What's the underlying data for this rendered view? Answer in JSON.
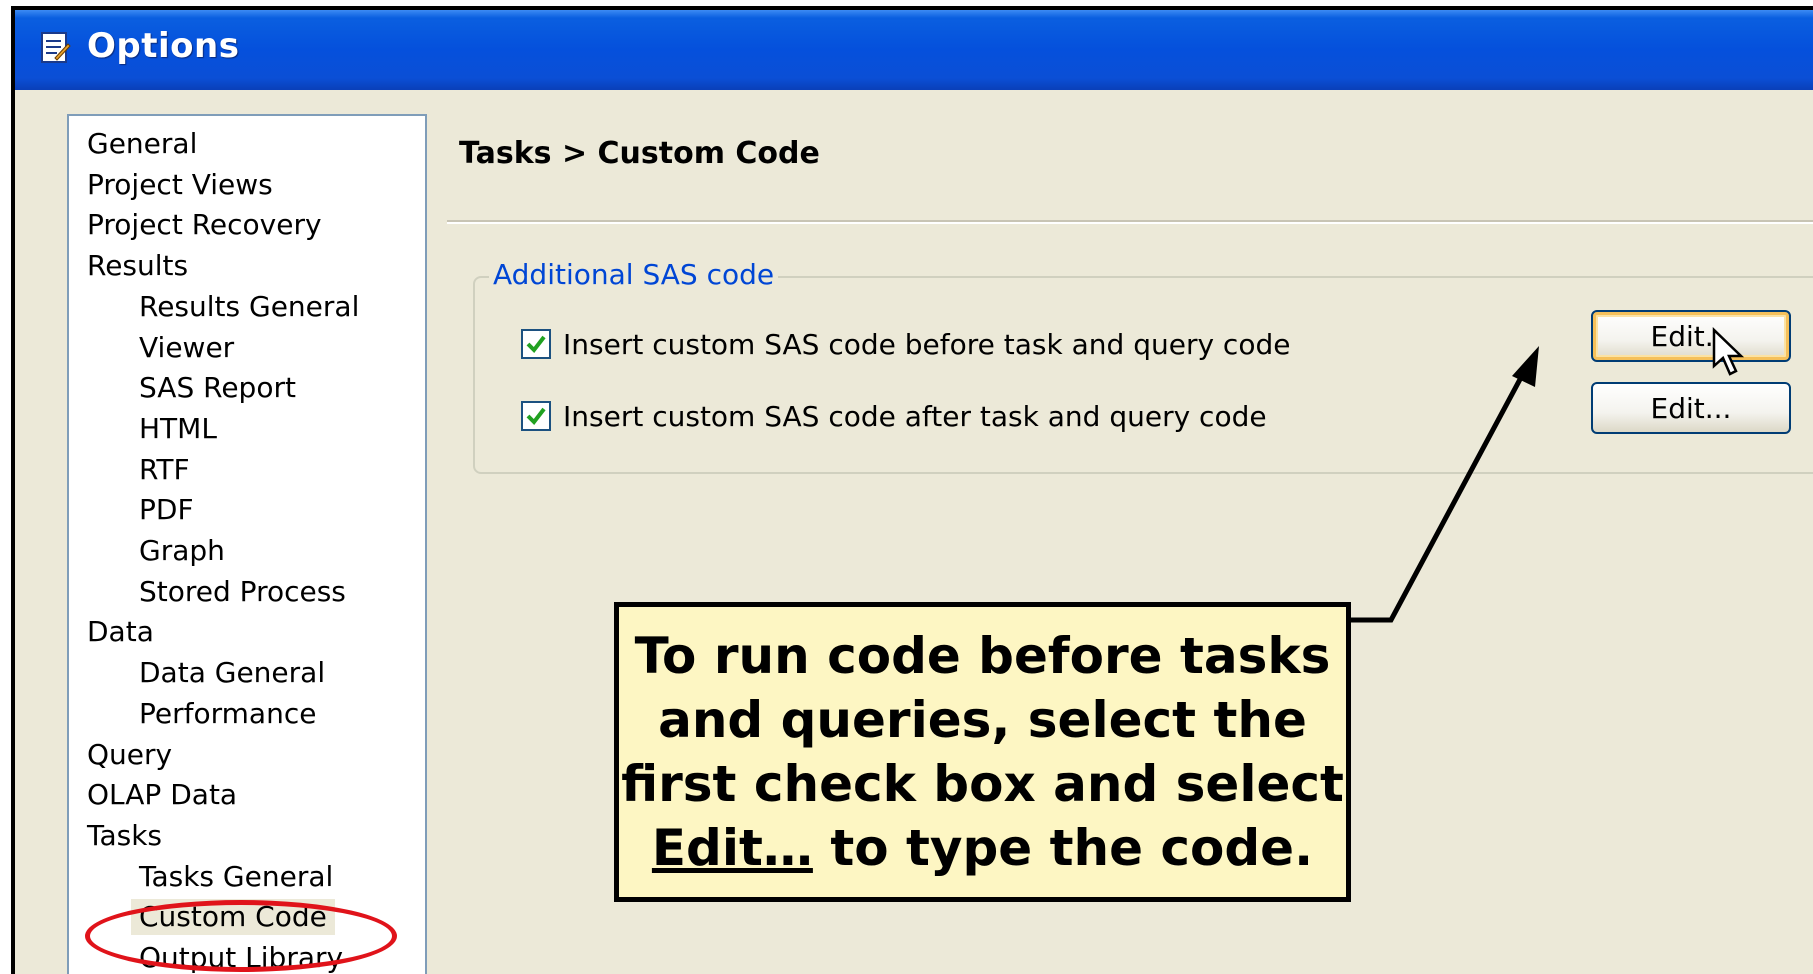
{
  "window": {
    "title": "Options",
    "icon": "options-dialog-icon"
  },
  "nav": {
    "items": [
      {
        "label": "General",
        "level": 0
      },
      {
        "label": "Project Views",
        "level": 0
      },
      {
        "label": "Project Recovery",
        "level": 0
      },
      {
        "label": "Results",
        "level": 0
      },
      {
        "label": "Results General",
        "level": 1
      },
      {
        "label": "Viewer",
        "level": 1
      },
      {
        "label": "SAS Report",
        "level": 1
      },
      {
        "label": "HTML",
        "level": 1
      },
      {
        "label": "RTF",
        "level": 1
      },
      {
        "label": "PDF",
        "level": 1
      },
      {
        "label": "Graph",
        "level": 1
      },
      {
        "label": "Stored Process",
        "level": 1
      },
      {
        "label": "Data",
        "level": 0
      },
      {
        "label": "Data General",
        "level": 1
      },
      {
        "label": "Performance",
        "level": 1
      },
      {
        "label": "Query",
        "level": 0
      },
      {
        "label": "OLAP Data",
        "level": 0
      },
      {
        "label": "Tasks",
        "level": 0
      },
      {
        "label": "Tasks General",
        "level": 1
      },
      {
        "label": "Custom Code",
        "level": 1,
        "selected": true
      },
      {
        "label": "Output Library",
        "level": 1
      }
    ]
  },
  "page": {
    "breadcrumb": "Tasks > Custom Code",
    "group_title": "Additional SAS code",
    "options": [
      {
        "label": "Insert custom SAS code before task and query code",
        "checked": true,
        "button_label": "Edit..."
      },
      {
        "label": "Insert custom SAS code after task and query code",
        "checked": true,
        "button_label": "Edit..."
      }
    ]
  },
  "callout": {
    "line1": "To run code before tasks",
    "line2": "and queries, select the",
    "line3": "first check box and select",
    "line4_link": "Edit…",
    "line4_rest": " to type the code."
  },
  "colors": {
    "titlebar": "#0550dc",
    "dialog_bg": "#ece9d8",
    "group_title": "#0046d5",
    "highlight_ellipse": "#e0131a",
    "callout_bg": "#fdf6c3",
    "checkmark": "#21a121"
  }
}
